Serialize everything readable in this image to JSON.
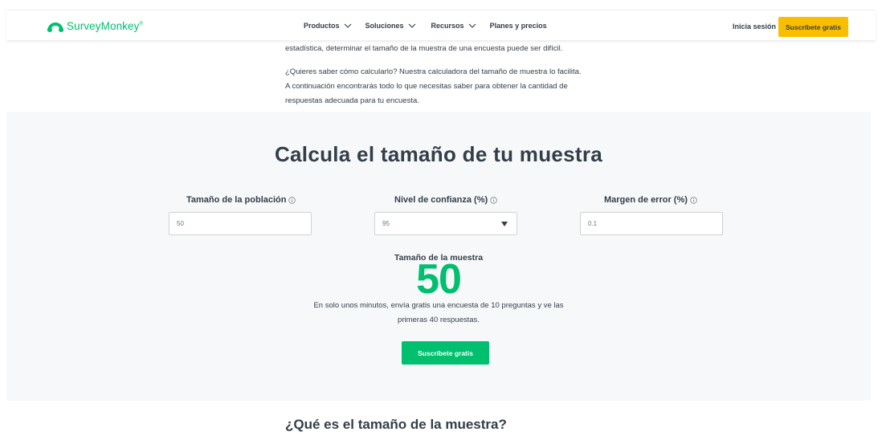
{
  "header": {
    "logo_text": "SurveyMonkey",
    "logo_tm": "®",
    "nav": [
      {
        "label": "Productos",
        "has_dropdown": true
      },
      {
        "label": "Soluciones",
        "has_dropdown": true
      },
      {
        "label": "Recursos",
        "has_dropdown": true
      },
      {
        "label": "Planes y precios",
        "has_dropdown": false
      }
    ],
    "login_label": "Inicia sesión",
    "signup_label": "Suscríbete gratis"
  },
  "intro": {
    "line1": "estadística, determinar el tamaño de la muestra de una encuesta puede ser difícil.",
    "line2": "¿Quieres saber cómo calcularlo? Nuestra calculadora del tamaño de muestra lo facilita.",
    "line3": "A continuación encontrarás todo lo que necesitas saber para obtener la cantidad de",
    "line4": "respuestas adecuada para tu encuesta."
  },
  "calculator": {
    "title": "Calcula el tamaño de tu muestra",
    "fields": [
      {
        "label": "Tamaño de la población",
        "value": "50"
      },
      {
        "label": "Nivel de confianza (%)",
        "value": "95"
      },
      {
        "label": "Margen de error (%)",
        "value": "0.1"
      }
    ],
    "result_label": "Tamaño de la muestra",
    "result_value": "50",
    "note_line1": "En solo unos minutos, envía gratis una encuesta de 10 preguntas y ve las",
    "note_line2": "primeras 40 respuestas.",
    "cta_label": "Suscríbete gratis"
  },
  "section": {
    "title": "¿Qué es el tamaño de la muestra?"
  },
  "colors": {
    "brand_green": "#00bf6f",
    "accent_yellow": "#f9be00",
    "text_dark": "#333e48",
    "section_bg": "#f7f8fa"
  }
}
